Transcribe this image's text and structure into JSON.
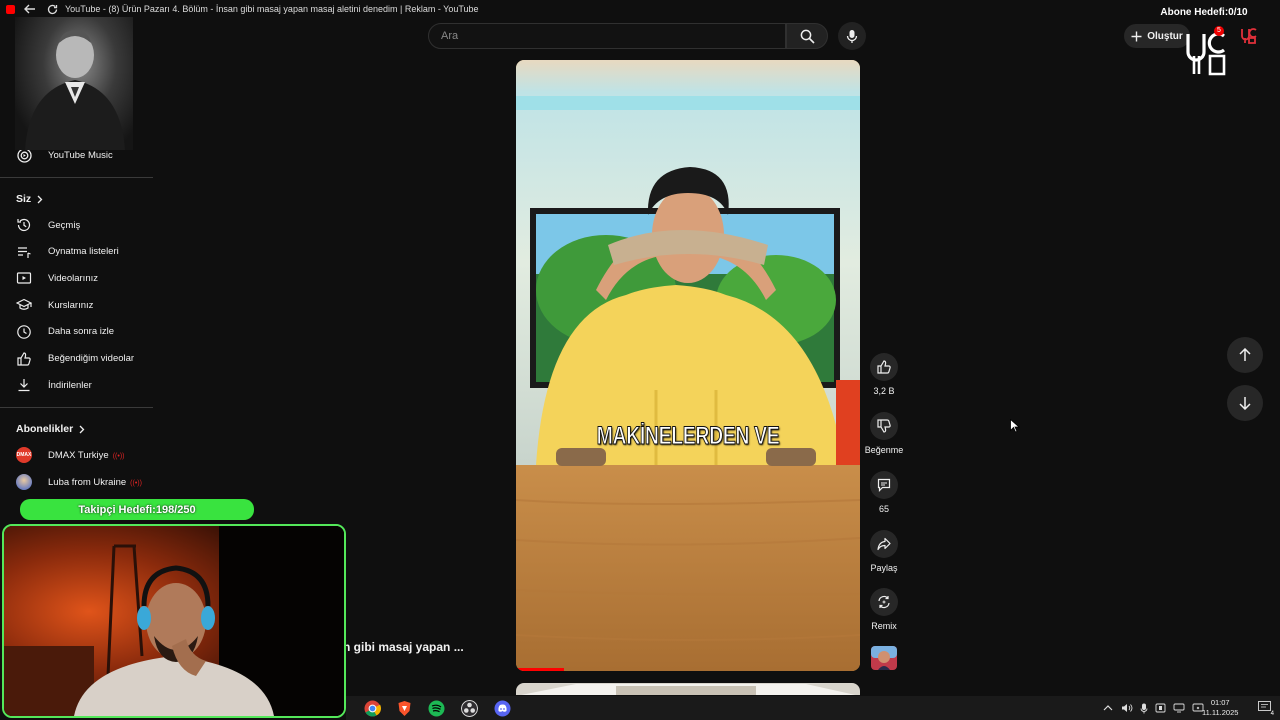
{
  "window": {
    "title": "YouTube - (8) Ürün Pazarı 4. Bölüm - İnsan gibi masaj yapan masaj aletini denedim | Reklam - YouTube"
  },
  "overlays": {
    "subscriber_goal": "Abone Hedefi:0/10",
    "follower_goal": "Takipçi Hedefi:198/250",
    "notif_count": "5"
  },
  "header": {
    "search_placeholder": "Ara",
    "create_label": "Oluştur"
  },
  "sidebar": {
    "music_label": "YouTube Music",
    "you_heading": "Siz",
    "items": [
      {
        "label": "Geçmiş",
        "icon": "history-icon"
      },
      {
        "label": "Oynatma listeleri",
        "icon": "playlist-icon"
      },
      {
        "label": "Videolarınız",
        "icon": "your-videos-icon"
      },
      {
        "label": "Kurslarınız",
        "icon": "courses-icon"
      },
      {
        "label": "Daha sonra izle",
        "icon": "watch-later-icon"
      },
      {
        "label": "Beğendiğim videolar",
        "icon": "liked-videos-icon"
      },
      {
        "label": "İndirilenler",
        "icon": "downloads-icon"
      }
    ],
    "subs_heading": "Abonelikler",
    "subscriptions": [
      {
        "label": "DMAX Turkiye",
        "avatar_text": "DMAX",
        "live": "((•))",
        "color": "#e03a2a"
      },
      {
        "label": "Luba from Ukraine",
        "live": "((•))",
        "color": "#6e7fbf"
      }
    ]
  },
  "video": {
    "subtitle": "MAKİNELERDEN VE",
    "progress": 0.14,
    "behind_title": "n gibi masaj yapan ..."
  },
  "actions": {
    "like_count": "3,2 B",
    "dislike_label": "Beğenme",
    "comment_count": "65",
    "share_label": "Paylaş",
    "remix_label": "Remix"
  },
  "taskbar": {
    "time": "01:07",
    "date": "11.11.2025",
    "notif_count": "4"
  },
  "colors": {
    "accent_red": "#ff0000",
    "goal_green": "#39e33f",
    "background": "#0f0f0f"
  }
}
